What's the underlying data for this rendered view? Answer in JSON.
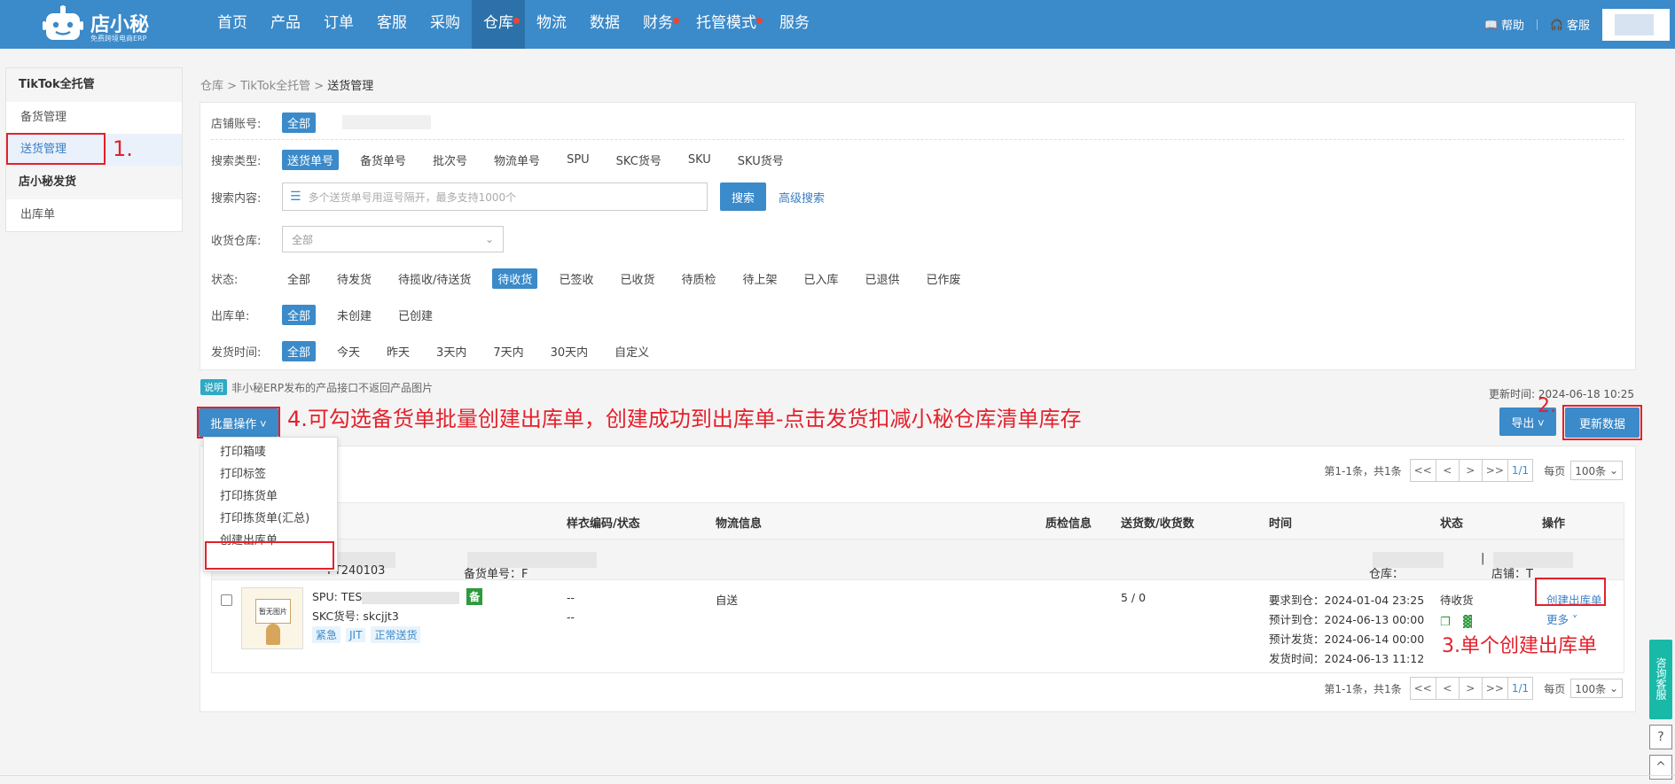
{
  "brand": {
    "name": "店小秘",
    "tagline": "免费跨境电商ERP"
  },
  "nav": [
    {
      "label": "首页",
      "dot": false,
      "active": false
    },
    {
      "label": "产品",
      "dot": false,
      "active": false
    },
    {
      "label": "订单",
      "dot": false,
      "active": false
    },
    {
      "label": "客服",
      "dot": false,
      "active": false
    },
    {
      "label": "采购",
      "dot": false,
      "active": false
    },
    {
      "label": "仓库",
      "dot": true,
      "active": true
    },
    {
      "label": "物流",
      "dot": false,
      "active": false
    },
    {
      "label": "数据",
      "dot": false,
      "active": false
    },
    {
      "label": "财务",
      "dot": true,
      "active": false
    },
    {
      "label": "托管模式",
      "dot": true,
      "active": false
    },
    {
      "label": "服务",
      "dot": false,
      "active": false
    }
  ],
  "topright": {
    "help": "帮助",
    "service": "客服"
  },
  "sidebar": {
    "section1": "TikTok全托管",
    "item1": "备货管理",
    "item2": "送货管理",
    "section2": "店小秘发货",
    "item3": "出库单"
  },
  "breadcrumb": {
    "l1": "仓库",
    "sep": ">",
    "l2": "TikTok全托管",
    "l3": "送货管理"
  },
  "filters": {
    "shop": {
      "label": "店铺账号:",
      "all": "全部"
    },
    "search_type": {
      "label": "搜索类型:",
      "options": [
        "送货单号",
        "备货单号",
        "批次号",
        "物流单号",
        "SPU",
        "SKC货号",
        "SKU",
        "SKU货号"
      ]
    },
    "search_content": {
      "label": "搜索内容:",
      "placeholder": "多个送货单号用逗号隔开，最多支持1000个",
      "button": "搜索",
      "advanced": "高级搜索"
    },
    "warehouse": {
      "label": "收货仓库:",
      "value": "全部"
    },
    "status": {
      "label": "状态:",
      "options": [
        "全部",
        "待发货",
        "待揽收/待送货",
        "待收货",
        "已签收",
        "已收货",
        "待质检",
        "待上架",
        "已入库",
        "已退供",
        "已作废"
      ]
    },
    "outbound": {
      "label": "出库单:",
      "options": [
        "全部",
        "未创建",
        "已创建"
      ]
    },
    "ship_time": {
      "label": "发货时间:",
      "options": [
        "全部",
        "今天",
        "昨天",
        "3天内",
        "7天内",
        "30天内",
        "自定义"
      ]
    }
  },
  "note": {
    "badge": "说明",
    "text": "非小秘ERP发布的产品接口不返回产品图片"
  },
  "update_time": "更新时间: 2024-06-18 10:25",
  "actions": {
    "batch": "批量操作",
    "export": "导出",
    "update": "更新数据"
  },
  "annotations": {
    "a1": "1.",
    "a2": "2.",
    "a3": "3.单个创建出库单",
    "a4": "4.可勾选备货单批量创建出库单，创建成功到出库单-点击发货扣减小秘仓库清单库存"
  },
  "dropdown": [
    "打印箱唛",
    "打印标签",
    "打印拣货单",
    "打印拣货单(汇总)",
    "创建出库单"
  ],
  "pager": {
    "summary": "第1-1条，共1条",
    "first": "<<",
    "prev": "<",
    "next": ">",
    "last": ">>",
    "page": "1/1",
    "per_label": "每页",
    "per_value": "100条"
  },
  "table": {
    "headers": {
      "sample": "样衣编码/状态",
      "logistics": "物流信息",
      "qc": "质检信息",
      "qty": "送货数/收货数",
      "time": "时间",
      "status": "状态",
      "ops": "操作"
    },
    "group": {
      "ship_no": "PT240103",
      "stock_label": "备货单号：F",
      "warehouse_label": "仓库：",
      "divider": "|",
      "shop_label": "店铺：T"
    },
    "row": {
      "thumb_text": "暂无图片",
      "spu": "SPU: TES",
      "bei": "备",
      "skc": "SKC货号: skcjjt3",
      "tags": [
        "紧急",
        "JIT",
        "正常送货"
      ],
      "sample1": "--",
      "sample2": "--",
      "logistics": "自送",
      "qty": "5 / 0",
      "times": [
        "要求到仓：2024-01-04 23:25",
        "预计到仓：2024-06-13 00:00",
        "预计发货：2024-06-14 00:00",
        "发货时间：2024-06-13 11:12"
      ],
      "status": "待收货",
      "op_create": "创建出库单",
      "op_more": "更多"
    }
  },
  "floating": {
    "consult": "咨询客服",
    "help": "?",
    "top": "^"
  },
  "colors": {
    "primary": "#3b8ac9",
    "annotation": "#e3212c",
    "badge": "#2eaac4"
  }
}
